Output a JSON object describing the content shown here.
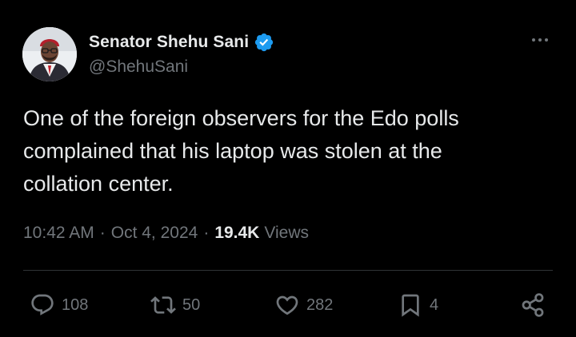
{
  "author": {
    "display_name": "Senator Shehu Sani",
    "handle": "@ShehuSani",
    "verified": true
  },
  "tweet": {
    "text": "One of the foreign observers for the Edo polls\ncomplained that his laptop was stolen at the\ncollation center.",
    "time": "10:42 AM",
    "date": "Oct 4, 2024",
    "separator": "·",
    "views_count": "19.4K",
    "views_label": "Views"
  },
  "actions": {
    "replies": "108",
    "reposts": "50",
    "likes": "282",
    "bookmarks": "4"
  },
  "colors": {
    "background": "#000000",
    "text_primary": "#e7e9ea",
    "text_secondary": "#71767b",
    "verified_blue": "#1d9bf0",
    "divider": "#2f3336"
  },
  "icons": {
    "verified": "verified-badge-icon",
    "more": "more-dots-icon",
    "reply": "reply-icon",
    "repost": "repost-icon",
    "like": "heart-icon",
    "bookmark": "bookmark-icon",
    "share": "share-icon"
  }
}
